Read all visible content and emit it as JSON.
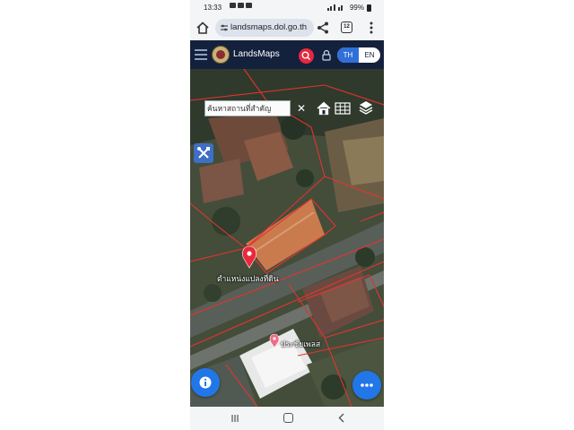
{
  "status_bar": {
    "time": "13:33",
    "battery": "99%"
  },
  "browser": {
    "url": "landsmaps.dol.go.th",
    "tab_count": "12"
  },
  "app": {
    "name": "LandsMaps",
    "lang_th": "TH",
    "lang_en": "EN",
    "active_language": "TH"
  },
  "map": {
    "search_placeholder": "ค้นหาสถานที่สำคัญ",
    "clear_symbol": "✕",
    "parcel_marker_label": "ตำแหน่งแปลงที่ดิน",
    "poi_label": "ประชัยเพลส",
    "colors": {
      "parcel_line": "#e5332f",
      "marker": "#e8283d",
      "header": "#14213d",
      "fab": "#2177e8"
    }
  },
  "icons": {
    "home": "home-icon",
    "share": "share-icon",
    "menu": "more-vert-icon",
    "hamburger": "hamburger-icon",
    "search": "search-icon",
    "lock": "lock-icon",
    "map_home": "home-map-icon",
    "grid": "grid-icon",
    "layers": "layers-icon",
    "tool": "tools-icon",
    "info": "info-icon",
    "more": "more-horiz-icon"
  }
}
